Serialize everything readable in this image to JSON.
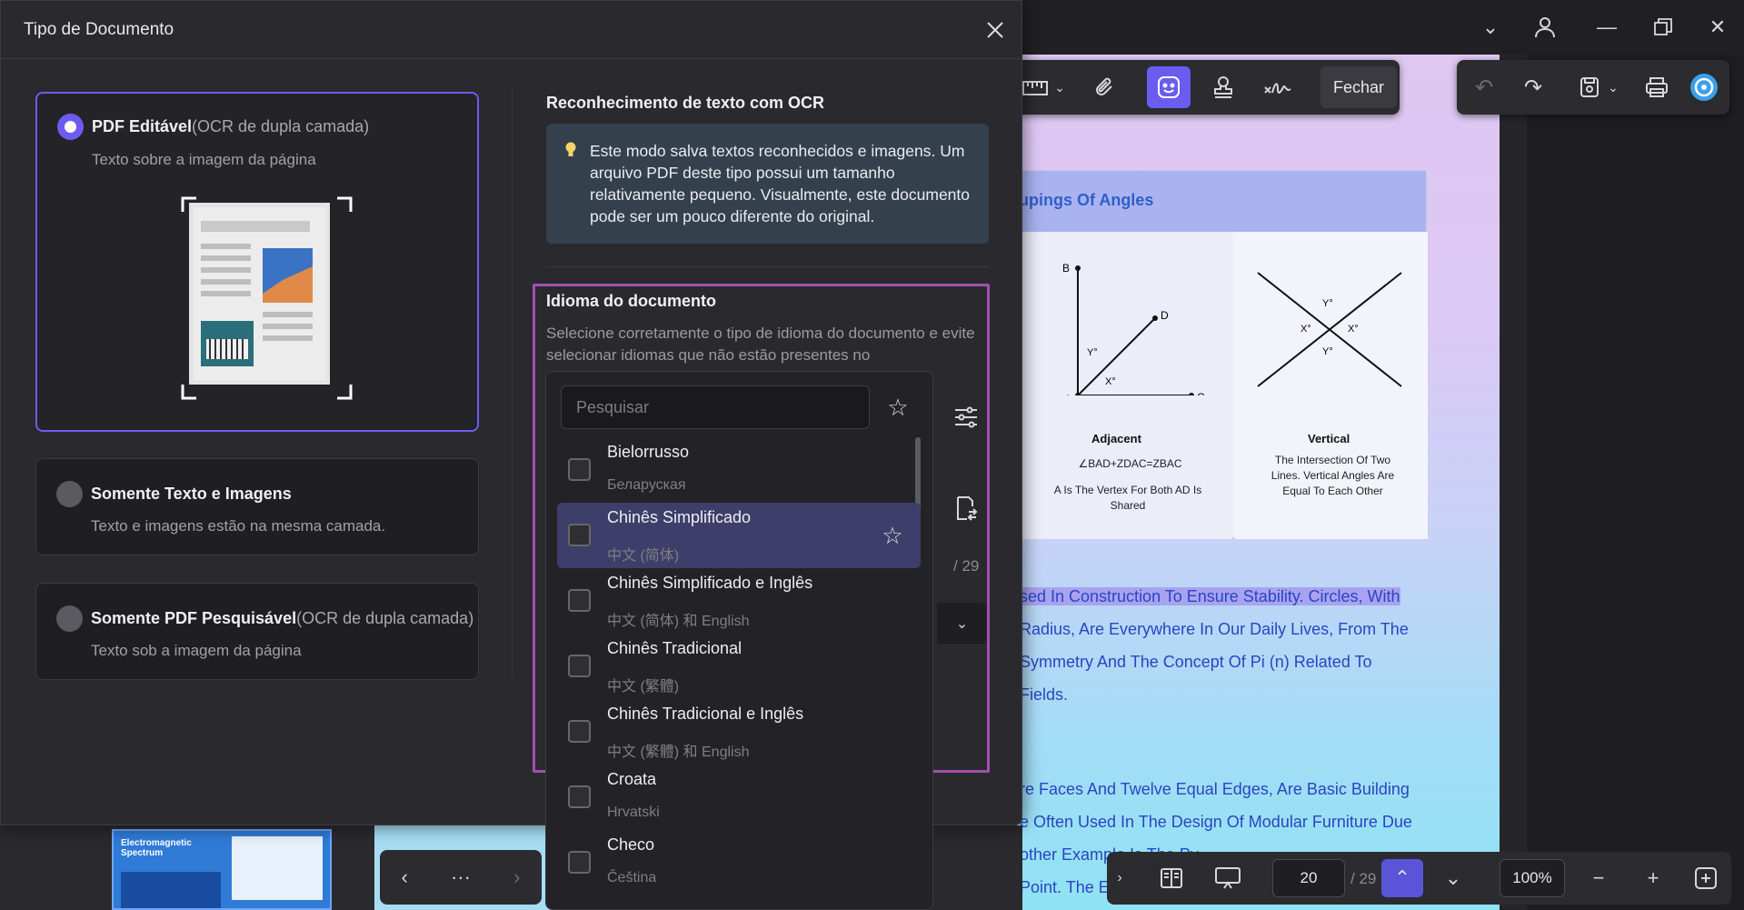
{
  "dialog": {
    "title": "Tipo de Documento",
    "options": [
      {
        "title": "PDF Editável",
        "subtitle": "(OCR de dupla camada)",
        "desc": "Texto sobre a imagem da página",
        "selected": true
      },
      {
        "title": "Somente Texto e Imagens",
        "subtitle": "",
        "desc": "Texto e imagens estão na mesma camada.",
        "selected": false
      },
      {
        "title": "Somente PDF Pesquisável",
        "subtitle": "(OCR de dupla camada)",
        "desc": "Texto sob a imagem da página",
        "selected": false
      }
    ],
    "ocr_section": {
      "title": "Reconhecimento de texto com OCR",
      "info": "Este modo salva textos reconhecidos e imagens. Um arquivo PDF deste tipo possui um tamanho relativamente pequeno. Visualmente, este documento pode ser um pouco diferente do original."
    },
    "language_section": {
      "title": "Idioma do documento",
      "desc": "Selecione corretamente o tipo de idioma do documento e evite selecionar idiomas que não estão presentes no",
      "search_placeholder": "Pesquisar",
      "page_total": "/ 29",
      "languages": [
        {
          "name": "Bielorrusso",
          "native": "Беларуская",
          "checked": false
        },
        {
          "name": "Chinês Simplificado",
          "native": "中文 (简体)",
          "checked": false,
          "hover": true
        },
        {
          "name": "Chinês Simplificado e Inglês",
          "native": "中文 (简体) 和 English",
          "checked": false
        },
        {
          "name": "Chinês Tradicional",
          "native": "中文 (繁體)",
          "checked": false
        },
        {
          "name": "Chinês Tradicional e Inglês",
          "native": "中文 (繁體) 和 English",
          "checked": false
        },
        {
          "name": "Croata",
          "native": "Hrvatski",
          "checked": false
        },
        {
          "name": "Checo",
          "native": "Čeština",
          "checked": false
        }
      ]
    }
  },
  "toolbar": {
    "close_label": "Fechar"
  },
  "document": {
    "card_title": "upings Of Angles",
    "fig_left": {
      "caption": "Adjacent",
      "formula": "∠BAD+ZDAC=ZBAC",
      "text": "A Is The Vertex For Both AD Is Shared"
    },
    "fig_right": {
      "caption": "Vertical",
      "text": "The Intersection Of Two Lines. Vertical Angles Are Equal To Each Other"
    },
    "paragraph1": [
      "sed In Construction To Ensure Stability. Circles, With",
      "Radius, Are Everywhere In Our Daily Lives, From The",
      "Symmetry And The Concept Of Pi (n) Related To",
      "Fields."
    ],
    "paragraph2": [
      "re Faces And Twelve Equal Edges, Are Basic Building",
      "e Often Used In The Design Of Modular Furniture Due",
      "other Example Is The Py",
      "Point. The Egyptian Py"
    ]
  },
  "bottom_bar": {
    "page_number": "20",
    "page_total": "/ 29",
    "zoom": "100%"
  },
  "thumbnail": {
    "title": "Electromagnetic Spectrum"
  },
  "colors": {
    "accent": "#6b5cf0",
    "highlight_border": "#a34fb0",
    "info_bg": "#34404c"
  }
}
